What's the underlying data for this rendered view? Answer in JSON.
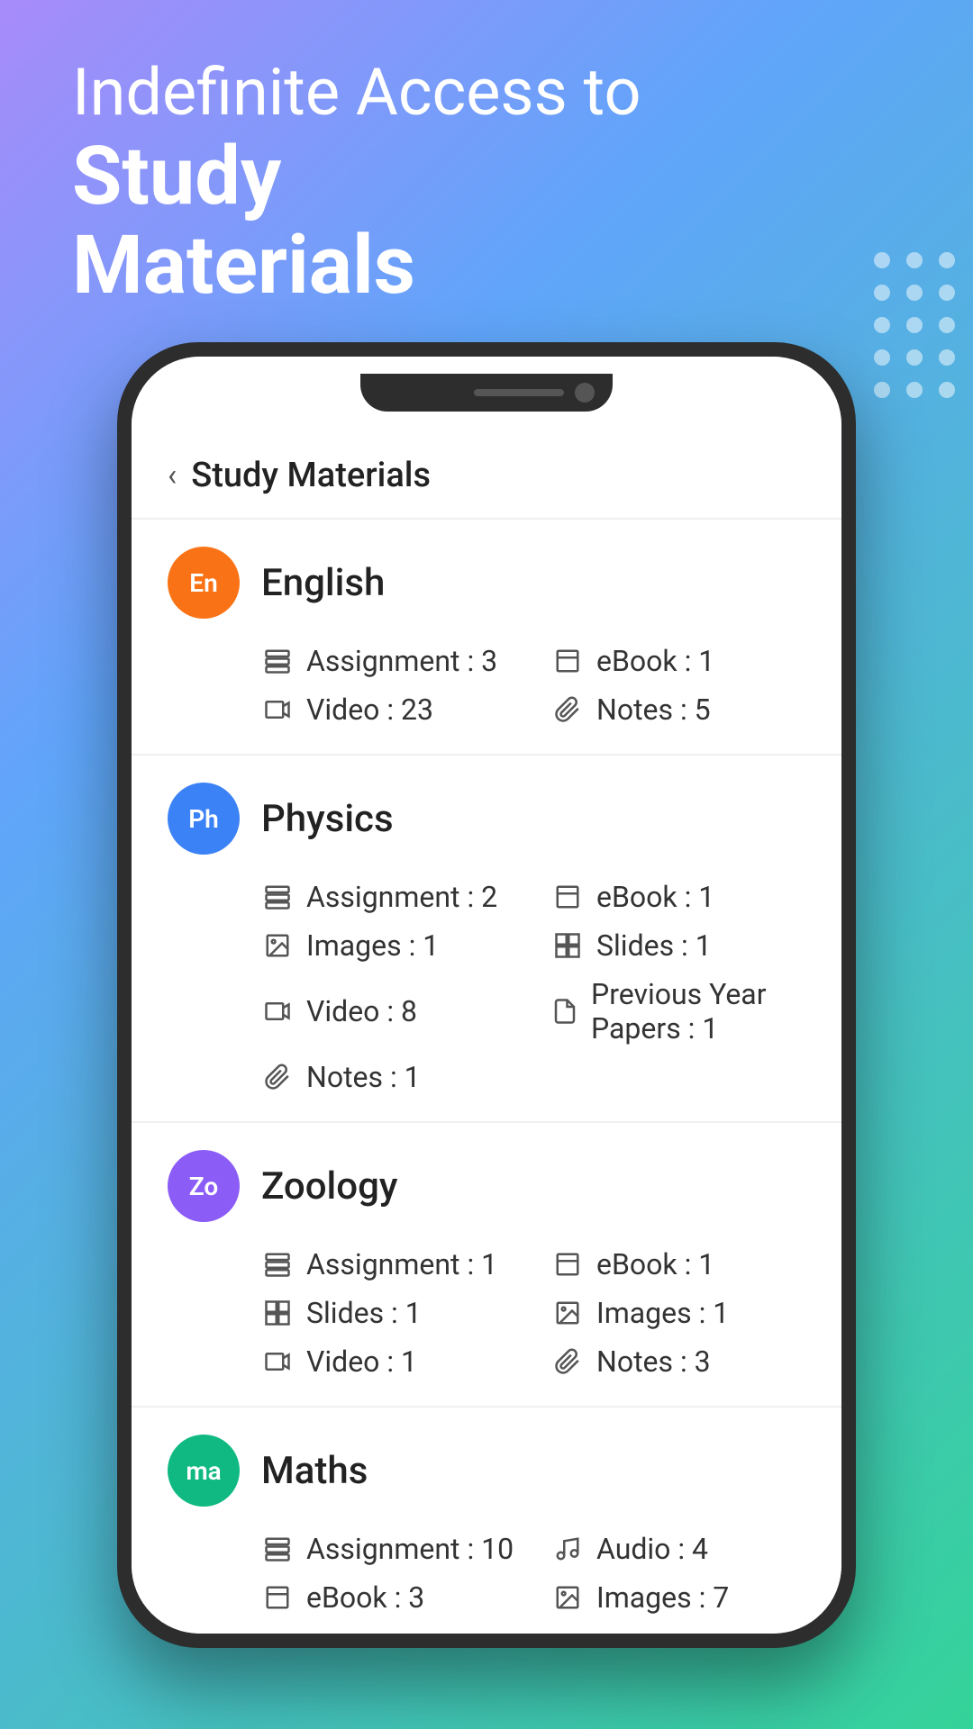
{
  "hero": {
    "line1": "Indefinite Access to",
    "line2": "Study\nMaterials"
  },
  "app": {
    "back_label": "<",
    "title": "Study Materials",
    "subjects": [
      {
        "id": "english",
        "abbr": "En",
        "name": "English",
        "avatar_class": "avatar-orange",
        "stats": [
          {
            "icon": "assignment",
            "label": "Assignment : 3"
          },
          {
            "icon": "ebook",
            "label": "eBook : 1"
          },
          {
            "icon": "video",
            "label": "Video : 23"
          },
          {
            "icon": "notes",
            "label": "Notes : 5"
          }
        ]
      },
      {
        "id": "physics",
        "abbr": "Ph",
        "name": "Physics",
        "avatar_class": "avatar-blue",
        "stats": [
          {
            "icon": "assignment",
            "label": "Assignment : 2"
          },
          {
            "icon": "ebook",
            "label": "eBook : 1"
          },
          {
            "icon": "images",
            "label": "Images : 1"
          },
          {
            "icon": "slides",
            "label": "Slides : 1"
          },
          {
            "icon": "video",
            "label": "Video : 8"
          },
          {
            "icon": "pyp",
            "label": "Previous Year Papers : 1"
          },
          {
            "icon": "notes",
            "label": "Notes : 1"
          },
          {
            "icon": "empty",
            "label": ""
          }
        ]
      },
      {
        "id": "zoology",
        "abbr": "Zo",
        "name": "Zoology",
        "avatar_class": "avatar-purple",
        "stats": [
          {
            "icon": "assignment",
            "label": "Assignment : 1"
          },
          {
            "icon": "ebook",
            "label": "eBook : 1"
          },
          {
            "icon": "slides",
            "label": "Slides : 1"
          },
          {
            "icon": "images",
            "label": "Images : 1"
          },
          {
            "icon": "video",
            "label": "Video : 1"
          },
          {
            "icon": "notes",
            "label": "Notes : 3"
          }
        ]
      },
      {
        "id": "maths",
        "abbr": "ma",
        "name": "Maths",
        "avatar_class": "avatar-green",
        "stats": [
          {
            "icon": "assignment",
            "label": "Assignment : 10"
          },
          {
            "icon": "audio",
            "label": "Audio : 4"
          },
          {
            "icon": "ebook",
            "label": "eBook : 3"
          },
          {
            "icon": "images",
            "label": "Images : 7"
          }
        ]
      }
    ]
  }
}
